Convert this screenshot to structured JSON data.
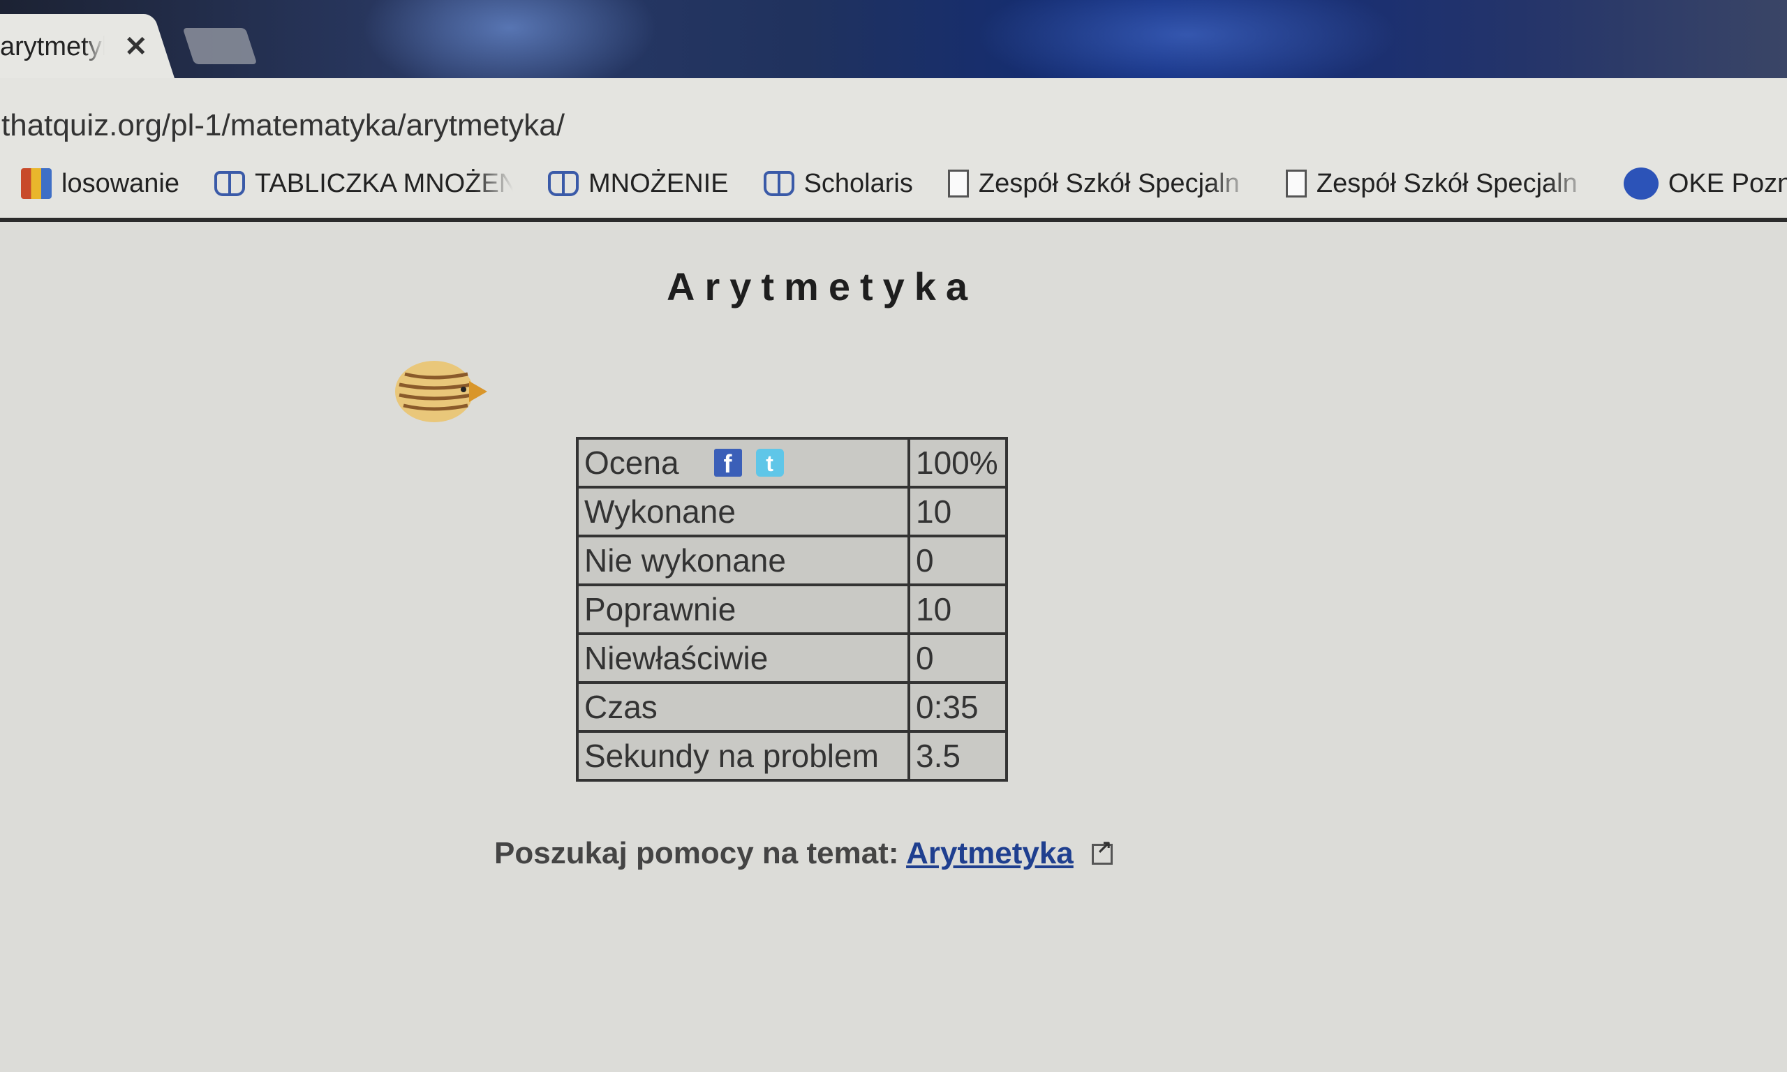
{
  "browser": {
    "tab_title": "arytmetyka",
    "tab_close": "✕",
    "url": "thatquiz.org/pl-1/matematyka/arytmetyka/",
    "bookmarks": [
      {
        "label": "losowanie",
        "icon": "tiles-icon"
      },
      {
        "label": "TABLICZKA MNOŻENI",
        "icon": "book-icon"
      },
      {
        "label": "MNOŻENIE",
        "icon": "book-icon"
      },
      {
        "label": "Scholaris",
        "icon": "book-icon"
      },
      {
        "label": "Zespół Szkół Specjaln",
        "icon": "page-icon"
      },
      {
        "label": "Zespół Szkół Specjaln",
        "icon": "page-icon"
      },
      {
        "label": "OKE Pozna",
        "icon": "oke-icon"
      }
    ]
  },
  "page": {
    "heading": "Arytmetyka",
    "results": [
      {
        "label": "Ocena",
        "value": "100%"
      },
      {
        "label": "Wykonane",
        "value": "10"
      },
      {
        "label": "Nie wykonane",
        "value": "0"
      },
      {
        "label": "Poprawnie",
        "value": "10"
      },
      {
        "label": "Niewłaściwie",
        "value": "0"
      },
      {
        "label": "Czas",
        "value": "0:35"
      },
      {
        "label": "Sekundy na problem",
        "value": "3.5"
      }
    ],
    "help_prefix": "Poszukaj pomocy na temat:",
    "help_link": "Arytmetyka",
    "facebook_icon_glyph": "f",
    "twitter_icon_glyph": "t"
  }
}
